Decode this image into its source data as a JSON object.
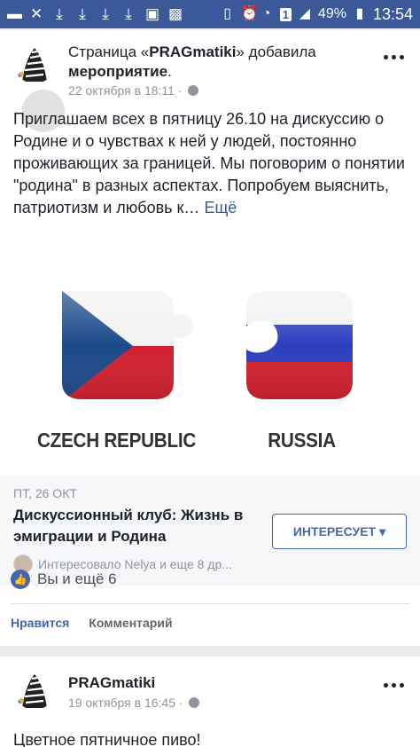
{
  "status_bar": {
    "left_icons": [
      "message-icon",
      "wrench-icon",
      "download-icon",
      "download-icon",
      "download-icon",
      "download-icon",
      "save-icon",
      "image-icon"
    ],
    "battery": "49%",
    "time": "13:54",
    "sim": "1"
  },
  "post1": {
    "page_prefix": "Страница «",
    "page_name": "PRAGmatiki",
    "page_suffix": "» добавила",
    "event_word": "мероприятие",
    "event_suffix": ".",
    "timestamp": "22 октября в 18:11 ·",
    "text": "Приглашаем всех в пятницу 26.10 на дискуссию о Родине и о чувствах к ней у людей, постоянно проживающих за границей. Мы поговорим о понятии \"родина\" в разных аспектах. Попробуем выяснить, патриотизм и любовь к…",
    "see_more": "Ещё",
    "image": {
      "left_label": "CZECH REPUBLIC",
      "right_label": "RUSSIA"
    },
    "event": {
      "date": "ПТ, 26 ОКТ",
      "title": "Дискуссионный клуб: Жизнь в эмиграции и Родина",
      "interest_button": "ИНТЕРЕСУЕТ",
      "interested_text": "Интересовало Nelya и еще 8 др..."
    },
    "likes_text": "Вы и ещё 6",
    "actions": {
      "like": "Нравится",
      "comment": "Комментарий"
    }
  },
  "post2": {
    "page_name": "PRAGmatiki",
    "timestamp": "19 октября в 16:45 ·",
    "text": "Цветное пятничное пиво!"
  },
  "colors": {
    "status_bar": "#3b5998",
    "link": "#365899",
    "button": "#4267b2"
  }
}
